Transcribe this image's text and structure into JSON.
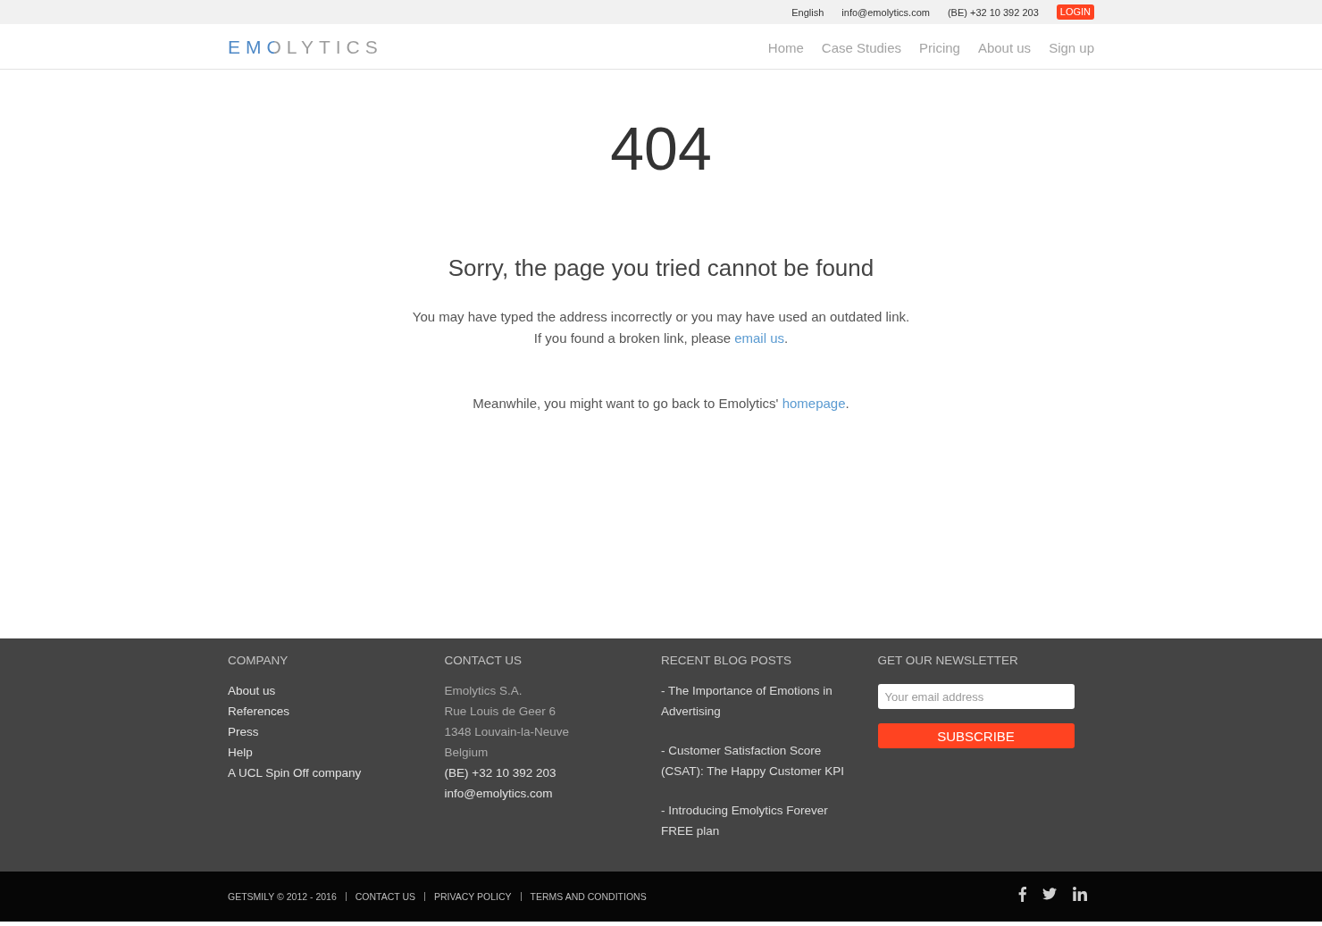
{
  "top_bar": {
    "language": "English",
    "email": "info@emolytics.com",
    "phone": "(BE) +32 10 392 203",
    "login_button": "LOGIN"
  },
  "header": {
    "logo": "EMOLYTICS",
    "nav": [
      "Home",
      "Case Studies",
      "Pricing",
      "About us",
      "Sign up"
    ]
  },
  "error": {
    "code": "404",
    "heading": "Sorry, the page you tried cannot be found",
    "paragraphs": [
      {
        "lines": [
          {
            "text": "You may have typed the address incorrectly or you may have used an outdated link."
          },
          {
            "text": "If you found a broken link, please ",
            "link": "email us",
            "tail": "."
          }
        ]
      },
      {
        "lines": [
          {
            "text": "Meanwhile, you might want to go back to Emolytics' ",
            "link": "homepage",
            "tail": "."
          }
        ]
      }
    ]
  },
  "footer": {
    "columns": [
      {
        "kind": "list",
        "title": "COMPANY",
        "items": [
          {
            "text": "About us",
            "kind": "link"
          },
          {
            "text": "References",
            "kind": "link"
          },
          {
            "text": "Press",
            "kind": "link"
          },
          {
            "text": "Help",
            "kind": "link"
          },
          {
            "text": "A UCL Spin Off company",
            "kind": "link"
          }
        ]
      },
      {
        "kind": "list",
        "title": "CONTACT US",
        "items": [
          {
            "text": "Emolytics S.A.",
            "kind": "text"
          },
          {
            "text": "Rue Louis de Geer 6",
            "kind": "text"
          },
          {
            "text": "1348 Louvain-la-Neuve",
            "kind": "text"
          },
          {
            "text": "Belgium",
            "kind": "text"
          },
          {
            "text": "(BE) +32 10 392 203",
            "kind": "link"
          },
          {
            "text": "info@emolytics.com",
            "kind": "link"
          }
        ]
      },
      {
        "kind": "posts",
        "title": "RECENT BLOG POSTS",
        "items": [
          "- The Importance of Emotions in Advertising",
          "- Customer Satisfaction Score (CSAT): The Happy Customer KPI",
          "- Introducing Emolytics Forever FREE plan"
        ]
      },
      {
        "kind": "newsletter",
        "title": "GET OUR NEWSLETTER",
        "placeholder": "Your email address",
        "button": "SUBSCRIBE"
      }
    ]
  },
  "bottom_bar": {
    "copyright": "GETSMILY © 2012 - 2016",
    "links": [
      "CONTACT US",
      "PRIVACY POLICY",
      "TERMS AND CONDITIONS"
    ]
  }
}
